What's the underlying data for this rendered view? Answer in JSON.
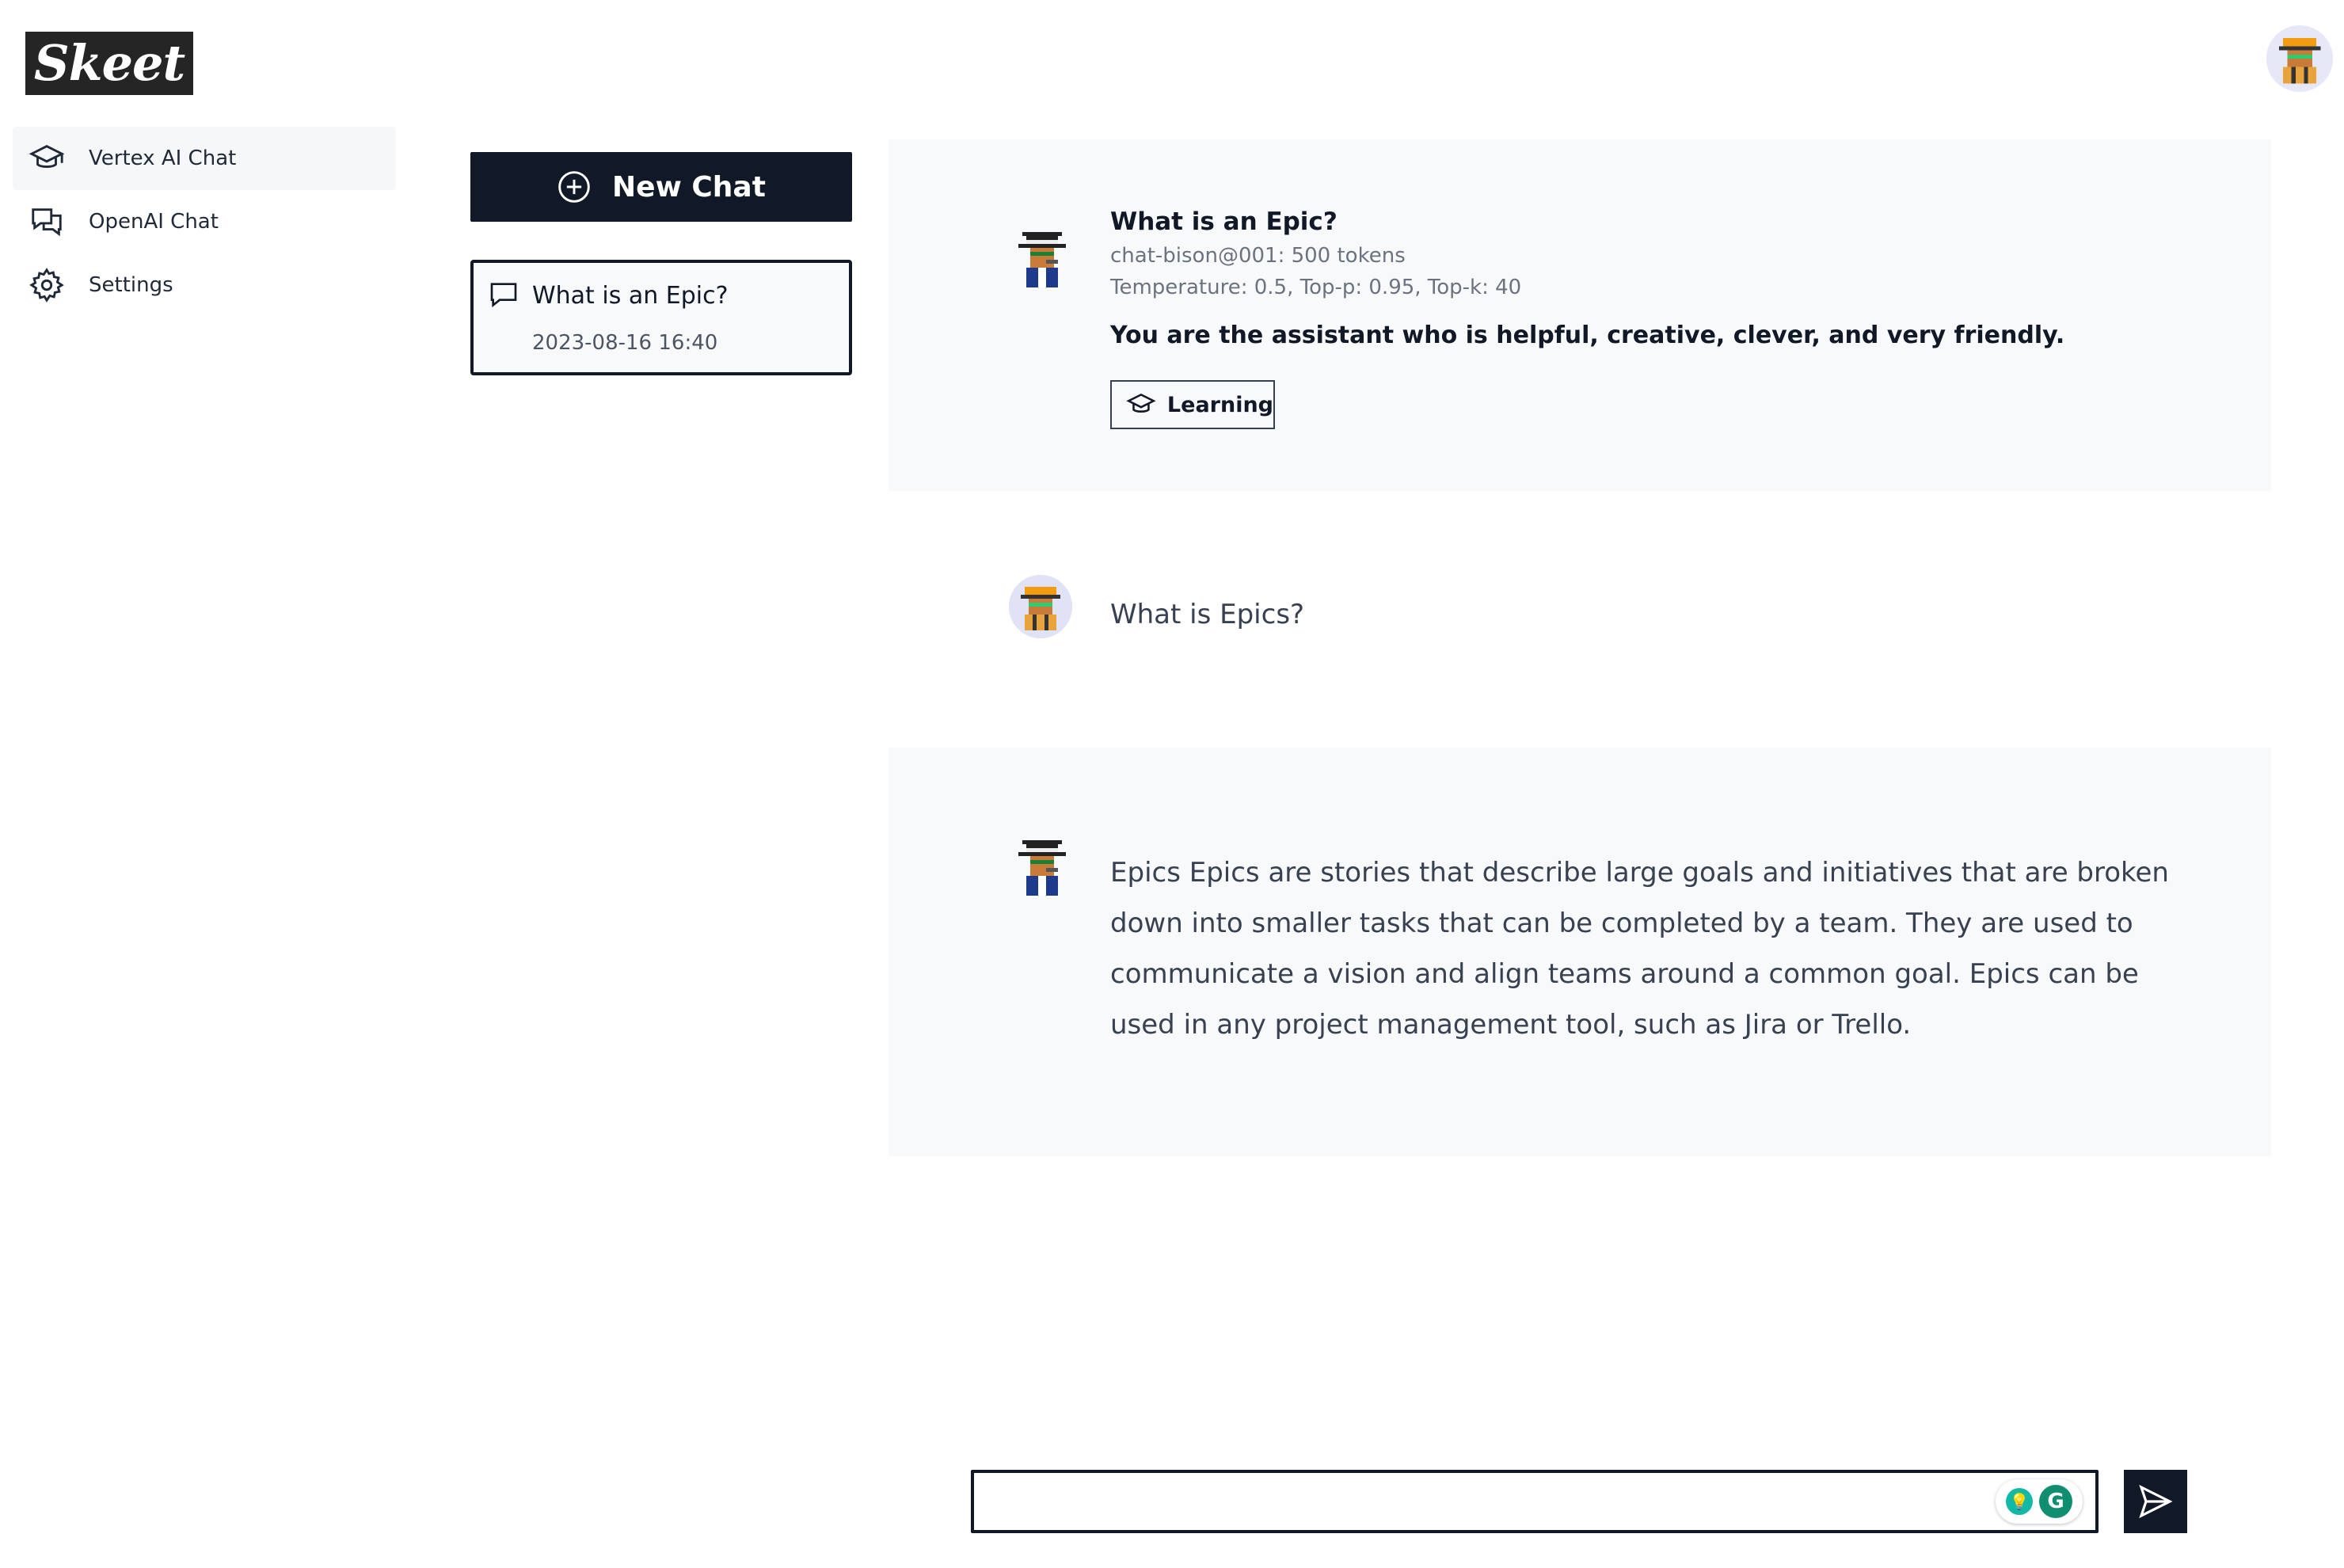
{
  "app": {
    "logo_text": "Skeet"
  },
  "sidebar": {
    "items": [
      {
        "label": "Vertex AI Chat",
        "icon": "graduation-cap-icon",
        "active": true
      },
      {
        "label": "OpenAI Chat",
        "icon": "chat-bubbles-icon",
        "active": false
      },
      {
        "label": "Settings",
        "icon": "gear-icon",
        "active": false
      }
    ]
  },
  "history": {
    "new_chat_label": "New Chat",
    "items": [
      {
        "title": "What is an Epic?",
        "date": "2023-08-16 16:40"
      }
    ]
  },
  "chat": {
    "system": {
      "title": "What is an Epic?",
      "model_line": "chat-bison@001: 500 tokens",
      "params_line": "Temperature: 0.5, Top-p: 0.95, Top-k: 40",
      "prompt": "You are the assistant who is helpful, creative, clever, and very friendly.",
      "tag_label": "Learning"
    },
    "user_message": "What is Epics?",
    "assistant_message": "Epics Epics are stories that describe large goals and initiatives that are broken down into smaller tasks that can be completed by a team. They are used to communicate a vision and align teams around a common goal. Epics can be used in any project management tool, such as Jira or Trello."
  },
  "input": {
    "value": "",
    "placeholder": ""
  },
  "colors": {
    "dark": "#111827",
    "panel_bg": "#f8f9fa",
    "active_bg": "#f6f7f9"
  }
}
